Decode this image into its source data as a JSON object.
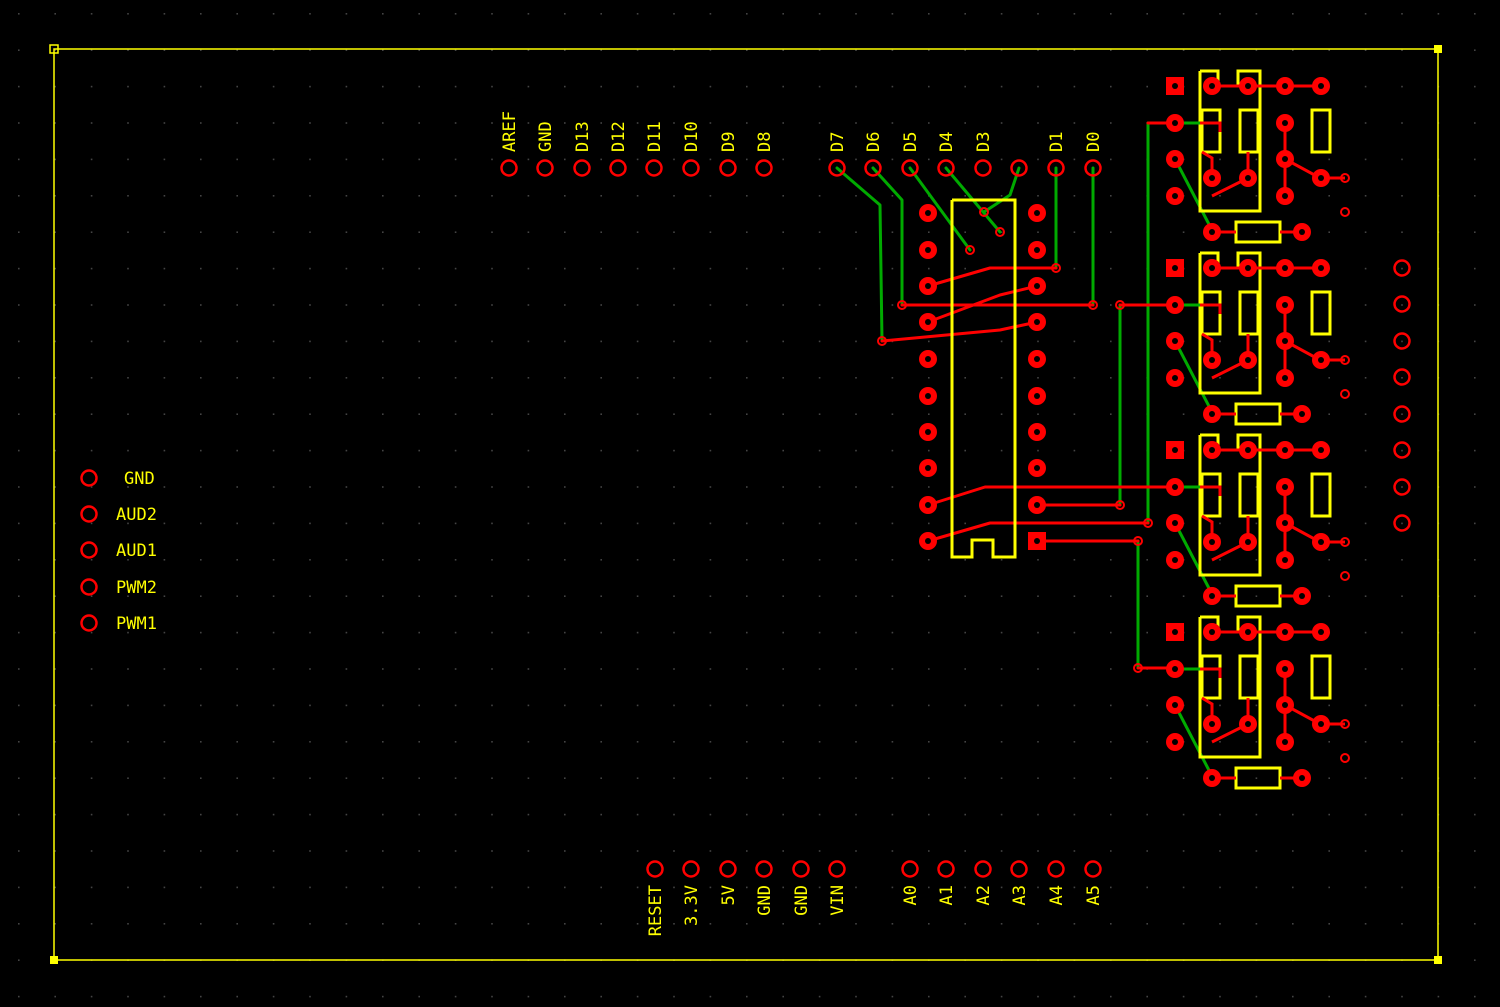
{
  "colors": {
    "background": "#000000",
    "grid_dot": "#444444",
    "silkscreen": "#ffff00",
    "copper_top": "#ff0000",
    "copper_bottom": "#00aa00"
  },
  "header_top": [
    "AREF",
    "GND",
    "D13",
    "D12",
    "D11",
    "D10",
    "D9",
    "D8"
  ],
  "header_top_right": [
    "D7",
    "D6",
    "D5",
    "D4",
    "D3",
    "",
    "D1",
    "D0"
  ],
  "header_bottom_left": [
    "RESET",
    "3.3V",
    "5V",
    "GND",
    "GND",
    "VIN"
  ],
  "header_bottom_right": [
    "A0",
    "A1",
    "A2",
    "A3",
    "A4",
    "A5"
  ],
  "side_header": [
    "GND",
    "AUD2",
    "AUD1",
    "PWM2",
    "PWM1"
  ]
}
